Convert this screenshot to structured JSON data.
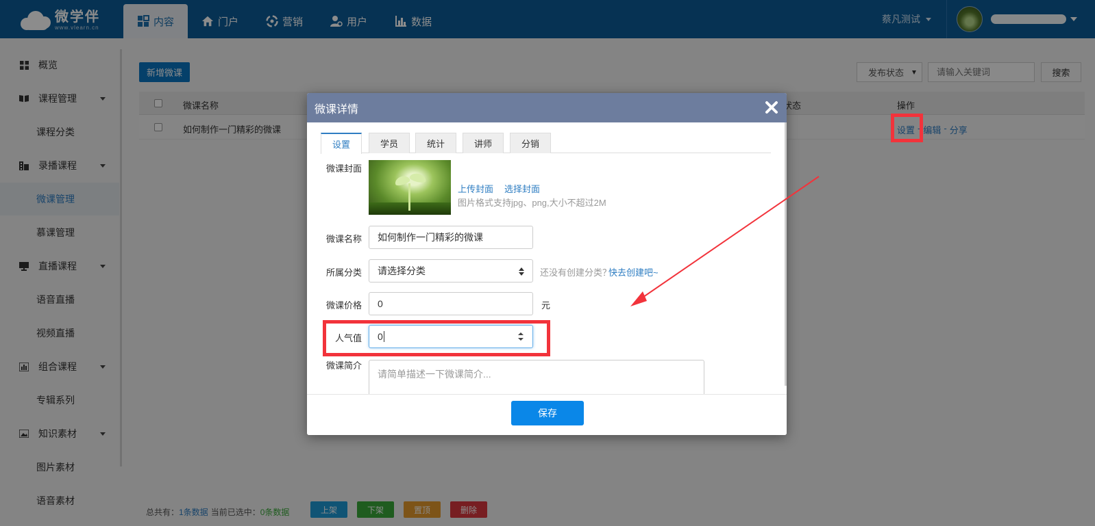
{
  "header": {
    "logo": {
      "brand": "微学伴",
      "url": "www.vlearn.cn"
    },
    "nav": [
      {
        "label": "内容",
        "icon": "grid-icon",
        "active": true
      },
      {
        "label": "门户",
        "icon": "home-icon",
        "active": false
      },
      {
        "label": "营销",
        "icon": "marketing-icon",
        "active": false
      },
      {
        "label": "用户",
        "icon": "user-icon",
        "active": false
      },
      {
        "label": "数据",
        "icon": "chart-icon",
        "active": false
      }
    ],
    "org_name": "蔡凡测试"
  },
  "sidebar": {
    "items": [
      {
        "label": "概览",
        "icon": "grid-icon",
        "type": "top"
      },
      {
        "label": "课程管理",
        "icon": "book-icon",
        "type": "group"
      },
      {
        "label": "课程分类",
        "type": "sub"
      },
      {
        "label": "录播课程",
        "icon": "film-icon",
        "type": "group"
      },
      {
        "label": "微课管理",
        "type": "sub",
        "active": true
      },
      {
        "label": "慕课管理",
        "type": "sub"
      },
      {
        "label": "直播课程",
        "icon": "monitor-icon",
        "type": "group"
      },
      {
        "label": "语音直播",
        "type": "sub"
      },
      {
        "label": "视频直播",
        "type": "sub"
      },
      {
        "label": "组合课程",
        "icon": "bar-chart-icon",
        "type": "group"
      },
      {
        "label": "专辑系列",
        "type": "sub"
      },
      {
        "label": "知识素材",
        "icon": "image-icon",
        "type": "group"
      },
      {
        "label": "图片素材",
        "type": "sub"
      },
      {
        "label": "语音素材",
        "type": "sub"
      }
    ]
  },
  "toolbar": {
    "new_label": "新增微课",
    "publish_status": "发布状态",
    "keyword_placeholder": "请输入关键词",
    "search_label": "搜索"
  },
  "table": {
    "columns": {
      "name": "微课名称",
      "status": "状态",
      "ops": "操作"
    },
    "rows": [
      {
        "name": "如何制作一门精彩的微课",
        "ops": [
          "设置",
          "编辑",
          "分享"
        ],
        "sep": "-"
      }
    ]
  },
  "footer": {
    "total_prefix": "总共有：",
    "total": "1条数据",
    "selected_prefix": "当前已选中：",
    "selected": "0条数据",
    "buttons": [
      {
        "label": "上架",
        "color": "#1e9ad6"
      },
      {
        "label": "下架",
        "color": "#3aa83a"
      },
      {
        "label": "置顶",
        "color": "#e39a2d"
      },
      {
        "label": "删除",
        "color": "#d9383e"
      }
    ]
  },
  "modal": {
    "title": "微课详情",
    "tabs": [
      "设置",
      "学员",
      "统计",
      "讲师",
      "分销"
    ],
    "cover": {
      "label": "微课封面",
      "upload": "上传封面",
      "choose": "选择封面",
      "hint": "图片格式支持jpg、png,大小不超过2M"
    },
    "name": {
      "label": "微课名称",
      "value": "如何制作一门精彩的微课"
    },
    "category": {
      "label": "所属分类",
      "value": "请选择分类",
      "hint": "还没有创建分类？",
      "link": "快去创建吧~"
    },
    "price": {
      "label": "微课价格",
      "value": "0",
      "unit": "元"
    },
    "popularity": {
      "label": "人气值",
      "value": "0"
    },
    "intro": {
      "label": "微课简介",
      "placeholder": "请简单描述一下微课简介..."
    },
    "save_label": "保存"
  },
  "colors": {
    "topbar": "#0b5c98",
    "accent": "#2e7dc2",
    "modal_header": "#6d7d9e",
    "highlight": "#f2333b",
    "save": "#0a87e8"
  }
}
